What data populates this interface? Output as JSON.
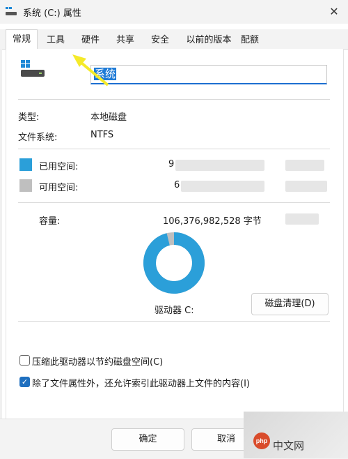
{
  "window": {
    "title": "系统 (C:) 属性",
    "close_glyph": "✕"
  },
  "tabs": [
    {
      "label": "常规",
      "active": true
    },
    {
      "label": "工具"
    },
    {
      "label": "硬件"
    },
    {
      "label": "共享"
    },
    {
      "label": "安全"
    },
    {
      "label": "以前的版本"
    },
    {
      "label": "配额"
    }
  ],
  "general": {
    "volume_name": "系统",
    "type_label": "类型:",
    "type_value": "本地磁盘",
    "fs_label": "文件系统:",
    "fs_value": "NTFS",
    "used_label": "已用空间:",
    "used_value_visible": "9",
    "free_label": "可用空间:",
    "free_value_visible": "6",
    "capacity_label": "容量:",
    "capacity_value": "106,376,982,528 字节",
    "drive_label": "驱动器 C:",
    "used_fraction": 0.96,
    "used_color": "#2b9fd9",
    "free_color": "#bfbfbf",
    "cleanup_button": "磁盘清理(D)",
    "compress_label": "压缩此驱动器以节约磁盘空间(C)",
    "compress_checked": false,
    "index_label": "除了文件属性外，还允许索引此驱动器上文件的内容(I)",
    "index_checked": true
  },
  "footer": {
    "ok_label": "确定",
    "cancel_label": "取消"
  },
  "watermark": {
    "logo_text": "php",
    "text": "中文网"
  },
  "icons": [
    "drive-icon",
    "close-icon",
    "checkbox-check-icon",
    "annotation-arrow-icon"
  ]
}
